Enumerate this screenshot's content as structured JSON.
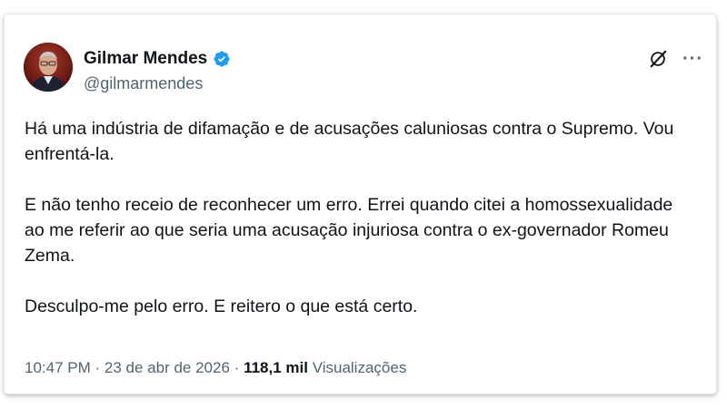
{
  "tweet": {
    "author_name": "Gilmar Mendes",
    "author_handle": "@gilmarmendes",
    "paragraphs": [
      "Há uma indústria de difamação e de acusações caluniosas contra o Supremo. Vou enfrentá-la.",
      "E não tenho receio de reconhecer um erro. Errei quando citei a homossexualidade ao me referir ao que seria uma acusação injuriosa contra o ex-governador Romeu Zema.",
      "Desculpo-me pelo erro. E reitero o que está certo."
    ],
    "time": "10:47 PM",
    "separator": "·",
    "date": "23 de abr de 2026",
    "views_count": "118,1 mil",
    "views_label": "Visualizações"
  },
  "icons": {
    "verified": "verified-badge-icon",
    "grok": "grok-icon",
    "more": "more-options-icon"
  },
  "colors": {
    "text": "#0f1419",
    "secondary": "#536471",
    "verified_blue": "#1d9bf0"
  }
}
